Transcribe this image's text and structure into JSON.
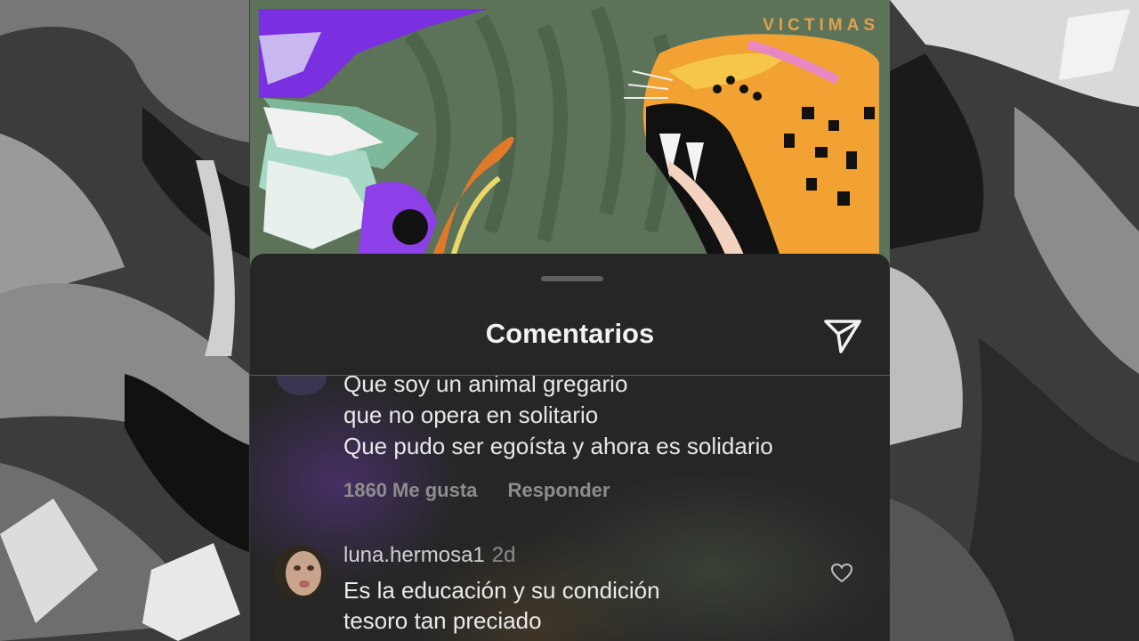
{
  "cover": {
    "title": "VICTIMAS"
  },
  "sheet": {
    "title": "Comentarios",
    "send_icon": "paper-plane-icon"
  },
  "comments": [
    {
      "lines": [
        "Que soy un animal gregario",
        "que no opera en solitario",
        "Que pudo ser egoísta y ahora es solidario"
      ],
      "likes": "1860 Me gusta",
      "reply": "Responder"
    },
    {
      "username": "luna.hermosa1",
      "time": "2d",
      "lines": [
        "Es la educación y su condición",
        "tesoro tan preciado"
      ],
      "like_icon": "heart-icon"
    }
  ],
  "colors": {
    "sheet_bg": "#262626",
    "cover_green": "#5c735a",
    "accent_purple": "#7a2fe0",
    "jaguar_orange": "#f0a030"
  }
}
